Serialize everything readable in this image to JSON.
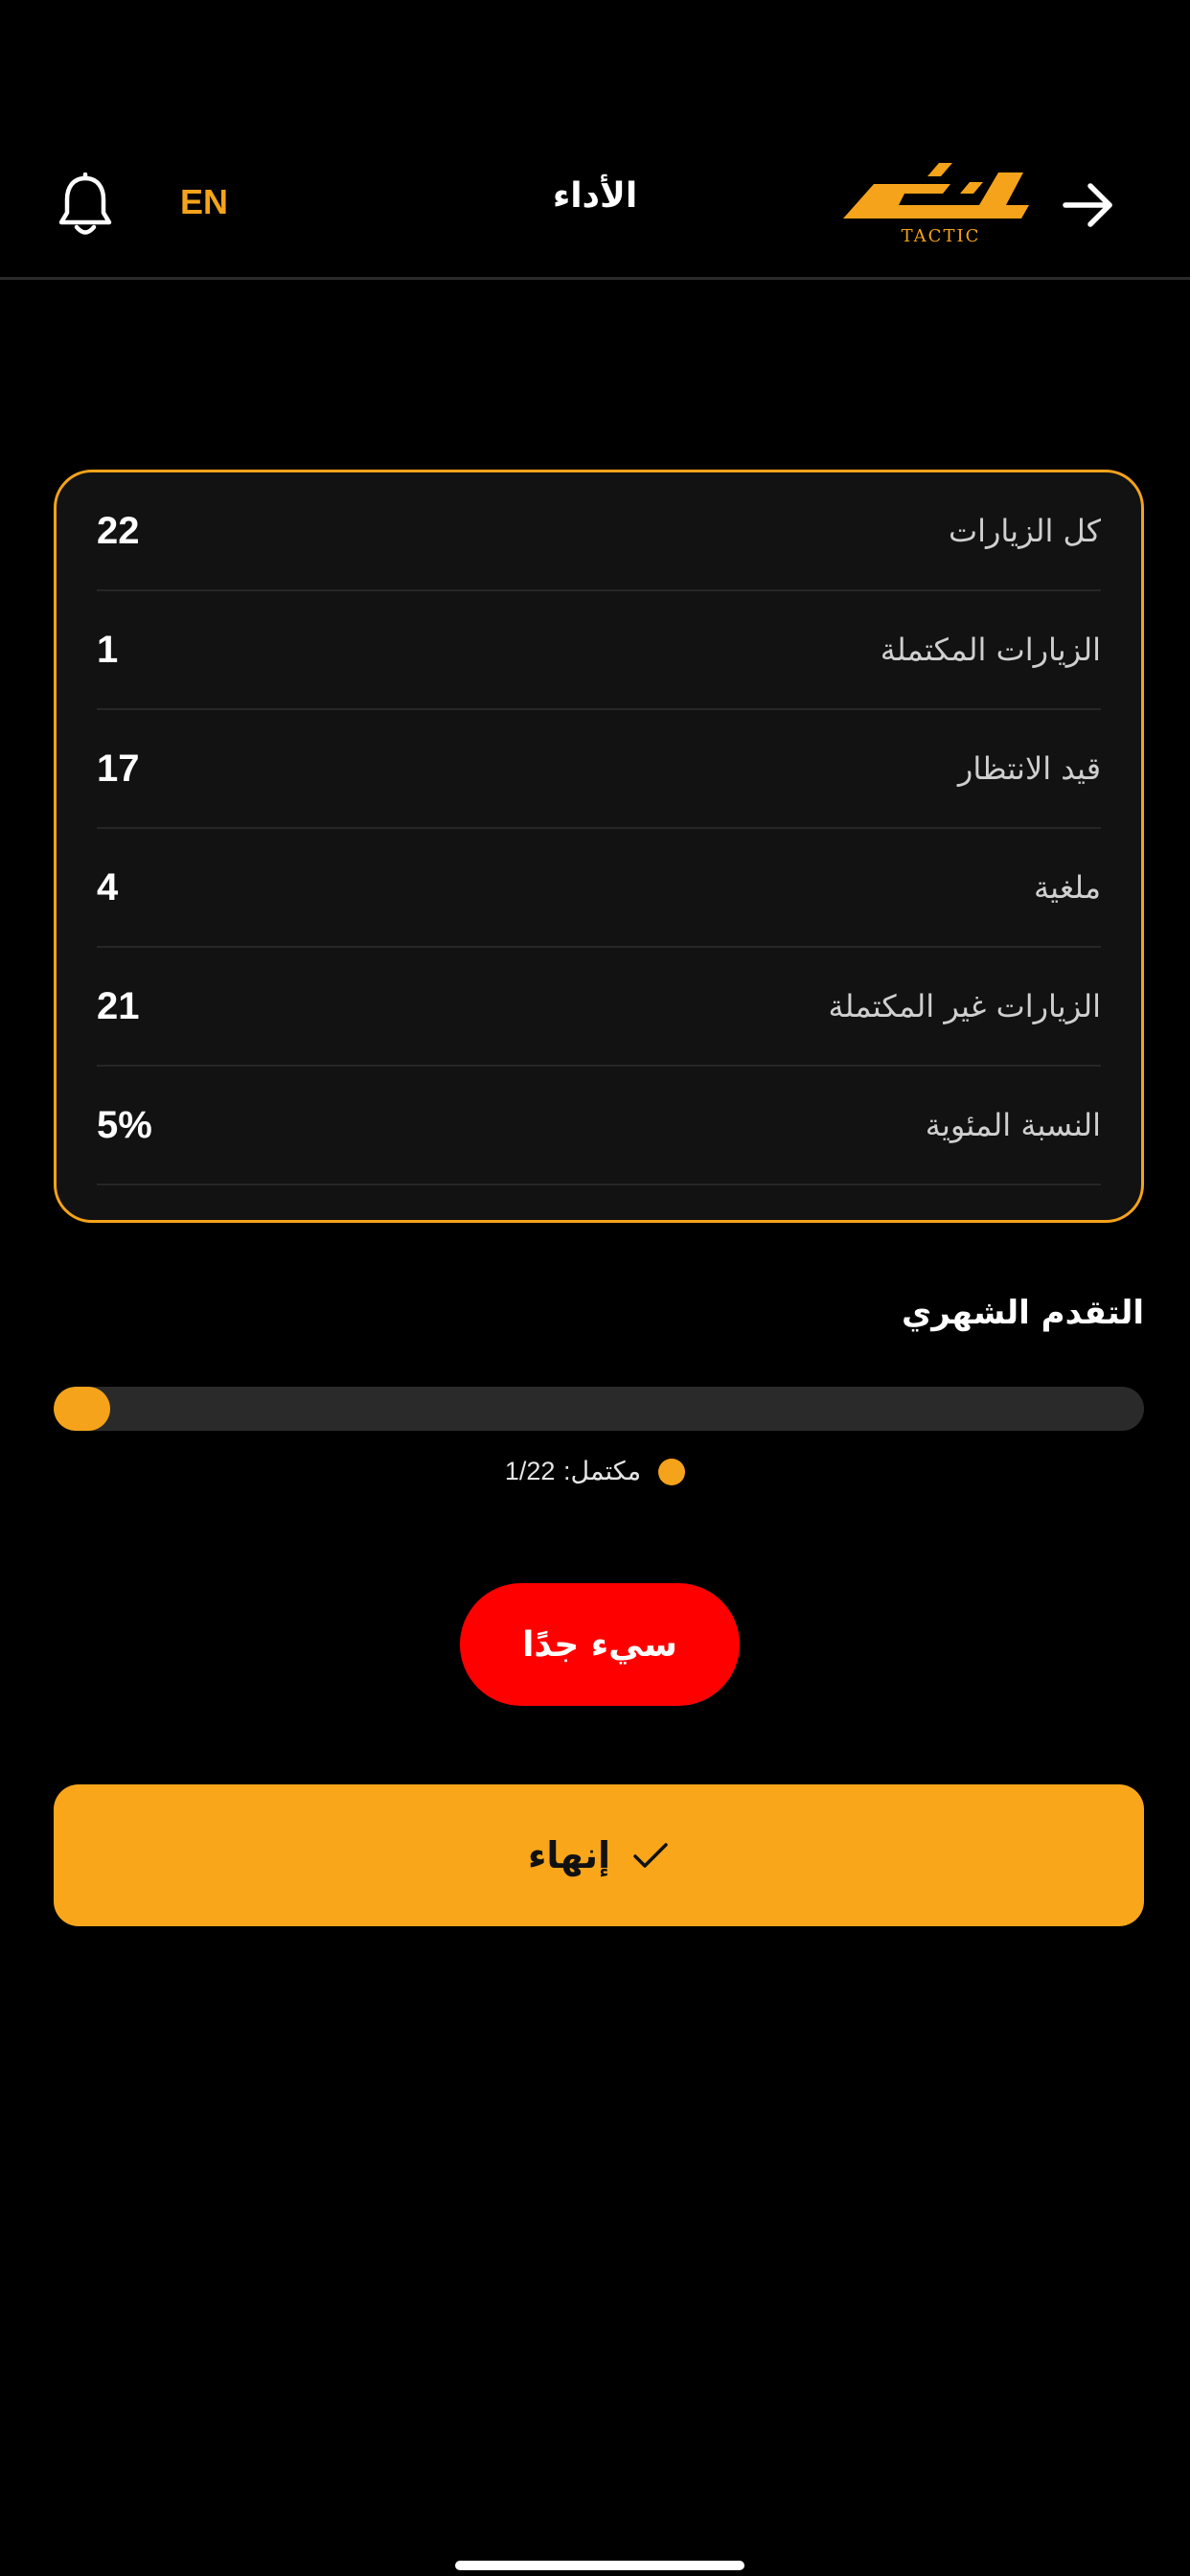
{
  "header": {
    "title": "الأداء",
    "language_toggle": "EN",
    "logo_arabic": "تكتيك",
    "logo_latin": "TACTIC"
  },
  "icons": {
    "bell": "bell-icon",
    "back": "arrow-right-icon",
    "check": "check-icon"
  },
  "stats": [
    {
      "label": "كل الزيارات",
      "value": "22"
    },
    {
      "label": "الزيارات المكتملة",
      "value": "1"
    },
    {
      "label": "قيد الانتظار",
      "value": "17"
    },
    {
      "label": "ملغية",
      "value": "4"
    },
    {
      "label": "الزيارات غير المكتملة",
      "value": "21"
    },
    {
      "label": "النسبة المئوية",
      "value": "5%"
    }
  ],
  "progress": {
    "title": "التقدم الشهري",
    "legend_label": "مكتمل:",
    "legend_value": "1/22",
    "completed_fraction": 0.045
  },
  "rating": {
    "label": "سيء جدًا"
  },
  "finish_button": {
    "label": "إنهاء"
  },
  "colors": {
    "accent": "#F5A31A",
    "rating_bad": "#FF0000",
    "background": "#000000",
    "card": "#121212"
  }
}
